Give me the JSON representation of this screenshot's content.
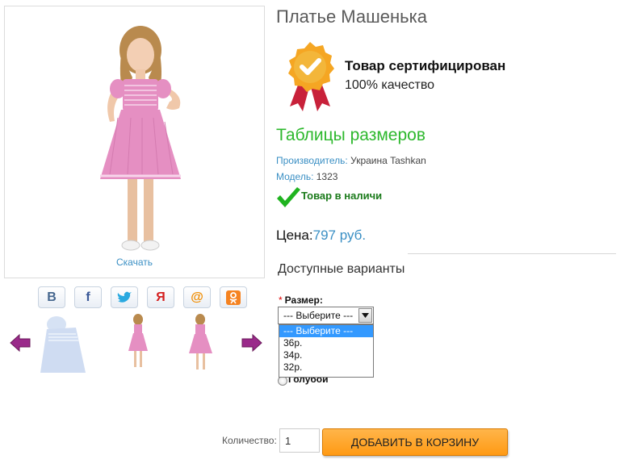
{
  "product": {
    "title": "Платье Машенька",
    "download_label": "Скачать"
  },
  "social": [
    {
      "name": "vk",
      "glyph": "В",
      "color": "#45668e"
    },
    {
      "name": "facebook",
      "glyph": "f",
      "color": "#3b5998"
    },
    {
      "name": "twitter",
      "glyph": "🐦",
      "color": "#2aa9e0"
    },
    {
      "name": "yaru",
      "glyph": "Я",
      "color": "#d42020"
    },
    {
      "name": "mail",
      "glyph": "@",
      "color": "#f08c00"
    },
    {
      "name": "odnoklassniki",
      "glyph": "ok",
      "color": "#f58220"
    }
  ],
  "certificate": {
    "title": "Товар сертифицирован",
    "subtitle": "100% качество"
  },
  "size_tables_link": "Таблицы размеров",
  "info": {
    "manufacturer_key": "Производитель:",
    "manufacturer_val": "Украина Tashkan",
    "model_key": "Модель:",
    "model_val": "1323",
    "stock": "Товар в наличи"
  },
  "price": {
    "label": "Цена:",
    "value": "797 руб."
  },
  "variants": {
    "title": "Доступные варианты",
    "size_label": "Размер:",
    "required_mark": "*",
    "select_value": "--- Выберите ---",
    "options": [
      "--- Выберите ---",
      "36р.",
      "34р.",
      "32р."
    ],
    "radio_label": "Голубой"
  },
  "cart": {
    "qty_label": "Количество:",
    "qty_value": "1",
    "add_button": "ДОБАВИТЬ В КОРЗИНУ"
  },
  "colors": {
    "dress_pink": "#e58fc2",
    "link_blue": "#3a8fc4",
    "green": "#2db82d",
    "button_orange": "#ff9a14",
    "arrow_purple": "#9a2a8a"
  }
}
